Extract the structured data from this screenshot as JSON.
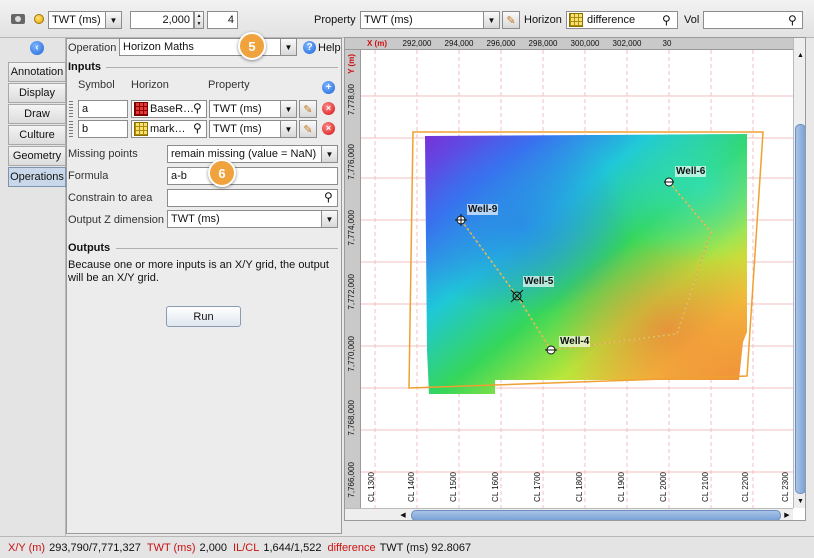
{
  "toolbar": {
    "domain": "TWT (ms)",
    "value": "2,000",
    "step": "4",
    "property_label": "Property",
    "property": "TWT (ms)",
    "horizon_label": "Horizon",
    "horizon": "difference",
    "vol_label": "Vol",
    "vol": ""
  },
  "tabs": [
    "Annotation",
    "Display",
    "Draw",
    "Culture",
    "Geometry",
    "Operations"
  ],
  "active_tab": "Operations",
  "panel": {
    "operation_label": "Operation",
    "operation": "Horizon Maths",
    "help_label": "Help",
    "inputs_title": "Inputs",
    "col_symbol": "Symbol",
    "col_horizon": "Horizon",
    "col_property": "Property",
    "rows": [
      {
        "symbol": "a",
        "horizon": "BaseR…",
        "property": "TWT (ms)"
      },
      {
        "symbol": "b",
        "horizon": "mark…",
        "property": "TWT (ms)"
      }
    ],
    "missing_label": "Missing points",
    "missing_value": "remain missing (value = NaN)",
    "formula_label": "Formula",
    "formula_value": "a-b",
    "constrain_label": "Constrain to area",
    "constrain_value": "",
    "outz_label": "Output Z dimension",
    "outz_value": "TWT (ms)",
    "outputs_title": "Outputs",
    "outputs_text": "Because one or more inputs is an X/Y grid, the output will be an X/Y grid.",
    "run_label": "Run"
  },
  "callouts": [
    "5",
    "6"
  ],
  "map": {
    "x_axis_label": "X (m)",
    "y_axis_label": "Y (m)",
    "x_ticks": [
      "292,000",
      "294,000",
      "296,000",
      "298,000",
      "300,000",
      "302,000",
      "30"
    ],
    "y_ticks": [
      "7,778,00",
      "7,776,000",
      "7,774,000",
      "7,772,000",
      "7,770,000",
      "7,768,000",
      "7,766,000"
    ],
    "cl_ticks": [
      "CL 1300",
      "CL 1400",
      "CL 1500",
      "CL 1600",
      "CL 1700",
      "CL 1800",
      "CL 1900",
      "CL 2000",
      "CL 2100",
      "CL 2200",
      "CL 2300"
    ],
    "wells": [
      "Well-9",
      "Well-6",
      "Well-5",
      "Well-4"
    ]
  },
  "status": {
    "xy_label": "X/Y (m)",
    "xy_value": "293,790/7,771,327",
    "twt_label": "TWT (ms)",
    "twt_value": "2,000",
    "ilcl_label": "IL/CL",
    "ilcl_value": "1,644/1,522",
    "diff_label": "difference",
    "diff_value": "TWT (ms) 92.8067"
  },
  "colors": {
    "accent": "#1d64d8",
    "status_label": "#cc1111",
    "callout": "#f0a33c",
    "polygon": "#f0a030"
  }
}
